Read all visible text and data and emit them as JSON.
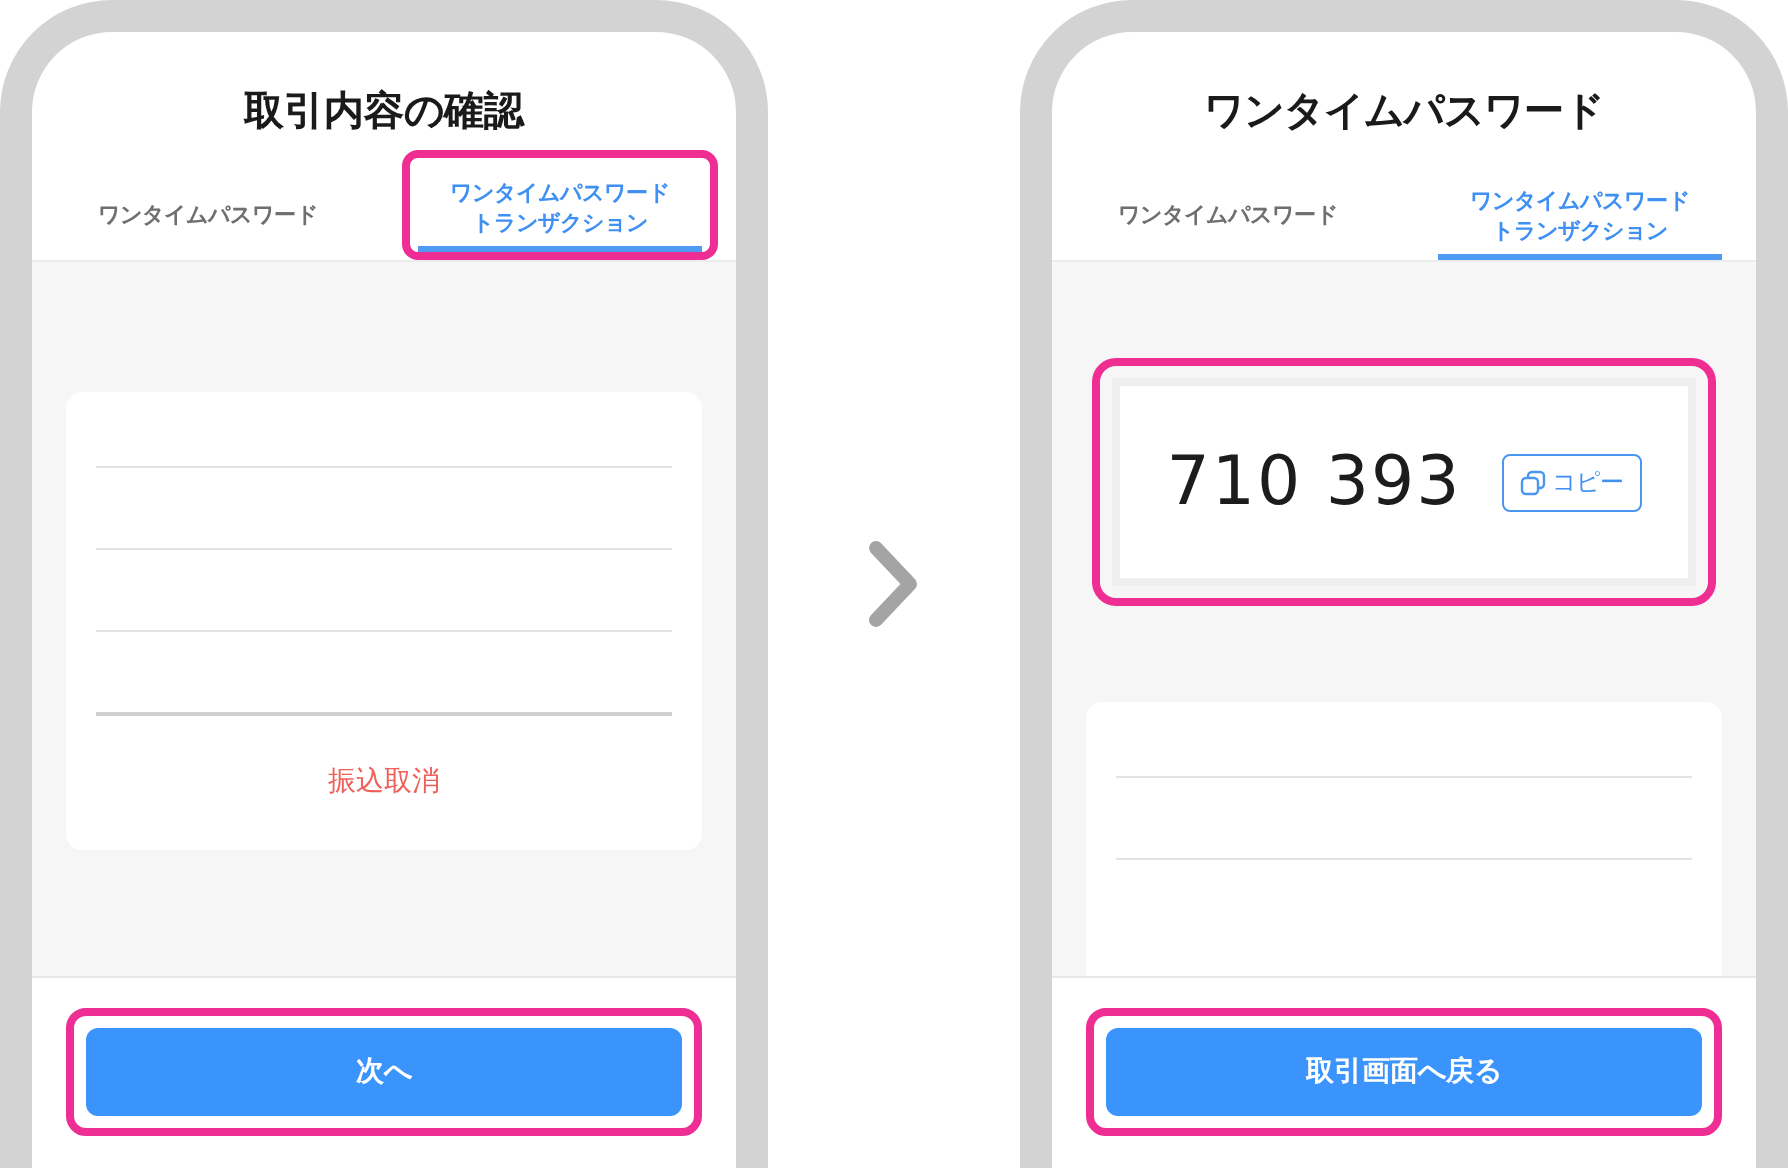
{
  "screens": [
    {
      "title": "取引内容の確認",
      "tabs": [
        {
          "lines": [
            "ワンタイムパスワード"
          ],
          "selected": false,
          "highlighted": false
        },
        {
          "lines": [
            "ワンタイムパスワード",
            "トランザクション"
          ],
          "selected": true,
          "highlighted": true
        }
      ],
      "panels": [
        {
          "kind": "transaction",
          "action": "振込取消"
        }
      ],
      "button": {
        "label": "次へ",
        "highlighted": true
      }
    },
    {
      "title": "ワンタイムパスワード",
      "tabs": [
        {
          "lines": [
            "ワンタイムパスワード"
          ],
          "selected": false,
          "highlighted": false
        },
        {
          "lines": [
            "ワンタイムパスワード",
            "トランザクション"
          ],
          "selected": true,
          "highlighted": false
        }
      ],
      "panels": [
        {
          "kind": "otp",
          "code": "710 393",
          "copy_label": "コピー",
          "highlighted": true
        },
        {
          "kind": "details"
        }
      ],
      "button": {
        "label": "取引画面へ戻る",
        "highlighted": true
      }
    }
  ]
}
